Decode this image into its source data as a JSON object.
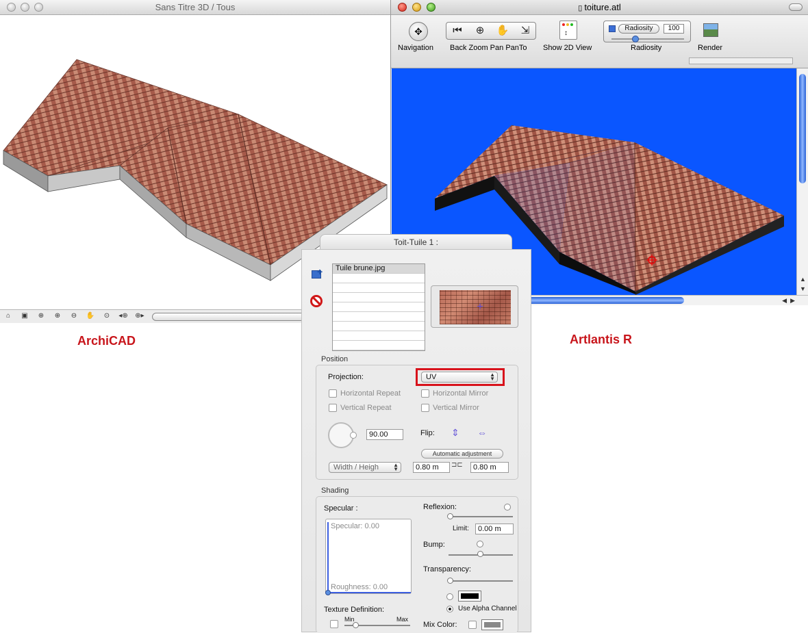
{
  "archicad": {
    "window_title": "Sans Titre 3D / Tous",
    "label": "ArchiCAD",
    "toolbar_icons": [
      "3d-view-icon",
      "zoom-rect-icon",
      "zoom-fit-icon",
      "zoom-in-icon",
      "zoom-out-icon",
      "pan-icon",
      "zoom-icon",
      "zoom-prev-icon",
      "zoom-next-icon"
    ]
  },
  "artlantis": {
    "window_title": "toiture.atl",
    "label": "Artlantis R",
    "toolbar": {
      "navigation_label": "Navigation",
      "back_zoom_label": "Back Zoom Pan PanTo",
      "show2d_label": "Show 2D View",
      "radiosity_label": "Radiosity",
      "radiosity_pill": "Radiosity",
      "radiosity_value": "100",
      "render_label": "Render"
    },
    "viewport_bg": "#0a56ff"
  },
  "palette": {
    "title": "Toit-Tuile 1 :",
    "textures": [
      "Tuile brune.jpg",
      "",
      "",
      "",
      "",
      "",
      "",
      "",
      ""
    ],
    "position_title": "Position",
    "projection_label": "Projection:",
    "projection_value": "UV",
    "horizontal_repeat": "Horizontal Repeat",
    "vertical_repeat": "Vertical Repeat",
    "horizontal_mirror": "Horizontal Mirror",
    "vertical_mirror": "Vertical Mirror",
    "angle_value": "90.00",
    "flip_label": "Flip:",
    "auto_adjust": "Automatic adjustment",
    "size_mode": "Width / Heigh",
    "width_value": "0.80 m",
    "height_value": "0.80 m",
    "shading_title": "Shading",
    "specular_label": "Specular :",
    "specular_value": "Specular: 0.00",
    "roughness_value": "Roughness: 0.00",
    "reflexion_label": "Reflexion:",
    "limit_label": "Limit:",
    "limit_value": "0.00 m",
    "bump_label": "Bump:",
    "transparency_label": "Transparency:",
    "alpha_label": "Use Alpha Channel",
    "texture_def_label": "Texture Definition:",
    "min_label": "Min",
    "max_label": "Max",
    "mix_color_label": "Mix Color:"
  },
  "accent_red": "#c8151b"
}
